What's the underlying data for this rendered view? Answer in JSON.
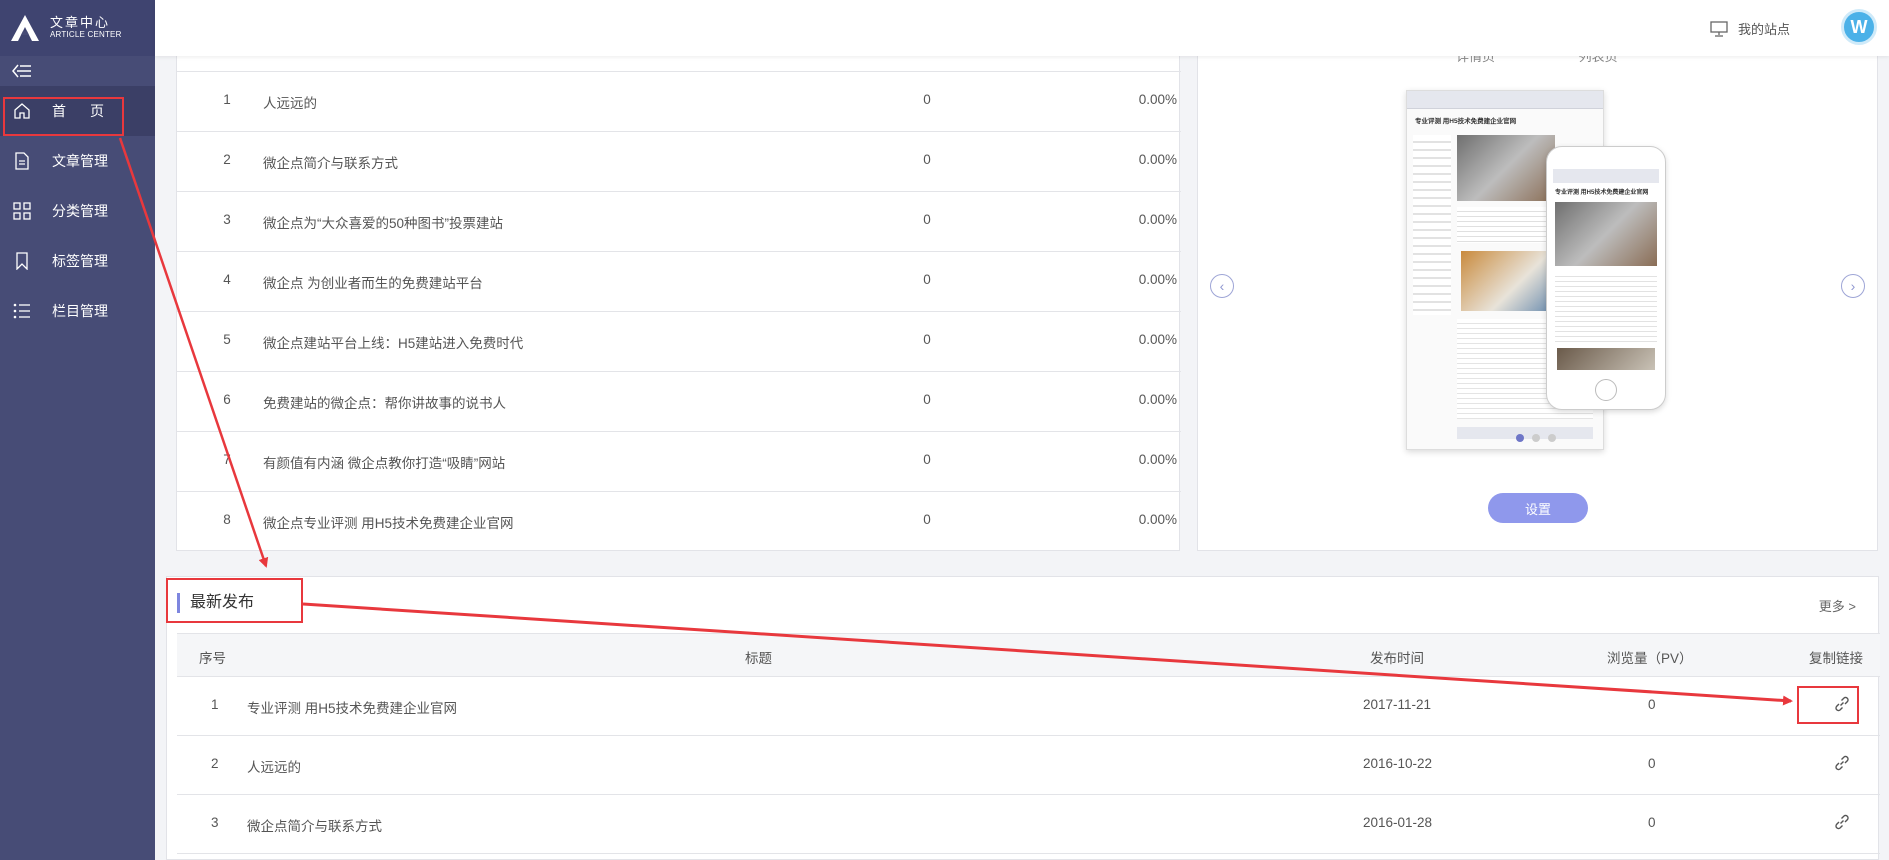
{
  "logo": {
    "title": "文章中心",
    "subtitle": "ARTICLE CENTER"
  },
  "sidebar": {
    "items": [
      {
        "label": "首页",
        "active": true
      },
      {
        "label": "文章管理"
      },
      {
        "label": "分类管理"
      },
      {
        "label": "标签管理"
      },
      {
        "label": "栏目管理"
      }
    ]
  },
  "header": {
    "my_site": "我的站点",
    "avatar_letter": "W"
  },
  "top_table": {
    "rows": [
      {
        "no": "1",
        "title": "人远远的",
        "pv": "0",
        "pct": "0.00%"
      },
      {
        "no": "2",
        "title": "微企点简介与联系方式",
        "pv": "0",
        "pct": "0.00%"
      },
      {
        "no": "3",
        "title": "微企点为“大众喜爱的50种图书”投票建站",
        "pv": "0",
        "pct": "0.00%"
      },
      {
        "no": "4",
        "title": "微企点 为创业者而生的免费建站平台",
        "pv": "0",
        "pct": "0.00%"
      },
      {
        "no": "5",
        "title": "微企点建站平台上线：H5建站进入免费时代",
        "pv": "0",
        "pct": "0.00%"
      },
      {
        "no": "6",
        "title": "免费建站的微企点：帮你讲故事的说书人",
        "pv": "0",
        "pct": "0.00%"
      },
      {
        "no": "7",
        "title": "有颜值有内涵 微企点教你打造“吸睛”网站",
        "pv": "0",
        "pct": "0.00%"
      },
      {
        "no": "8",
        "title": "微企点专业评测 用H5技术免费建企业官网",
        "pv": "0",
        "pct": "0.00%"
      }
    ]
  },
  "preview": {
    "tabs": [
      "详情页",
      "列表页"
    ],
    "desktop_headline": "专业评测 用H5技术免费建企业官网",
    "phone_headline": "专业评测 用H5技术免费建企业官网",
    "set_button": "设置",
    "dots": 3,
    "active_dot": 0
  },
  "latest": {
    "title": "最新发布",
    "more": "更多 >",
    "columns": {
      "no": "序号",
      "title": "标题",
      "date": "发布时间",
      "pv": "浏览量（PV）",
      "copy": "复制链接"
    },
    "rows": [
      {
        "no": "1",
        "title": "专业评测 用H5技术免费建企业官网",
        "date": "2017-11-21",
        "pv": "0"
      },
      {
        "no": "2",
        "title": "人远远的",
        "date": "2016-10-22",
        "pv": "0"
      },
      {
        "no": "3",
        "title": "微企点简介与联系方式",
        "date": "2016-01-28",
        "pv": "0"
      }
    ]
  },
  "colors": {
    "sidebar": "#474c76",
    "accent": "#7e86df",
    "annotation": "#e8383d"
  }
}
